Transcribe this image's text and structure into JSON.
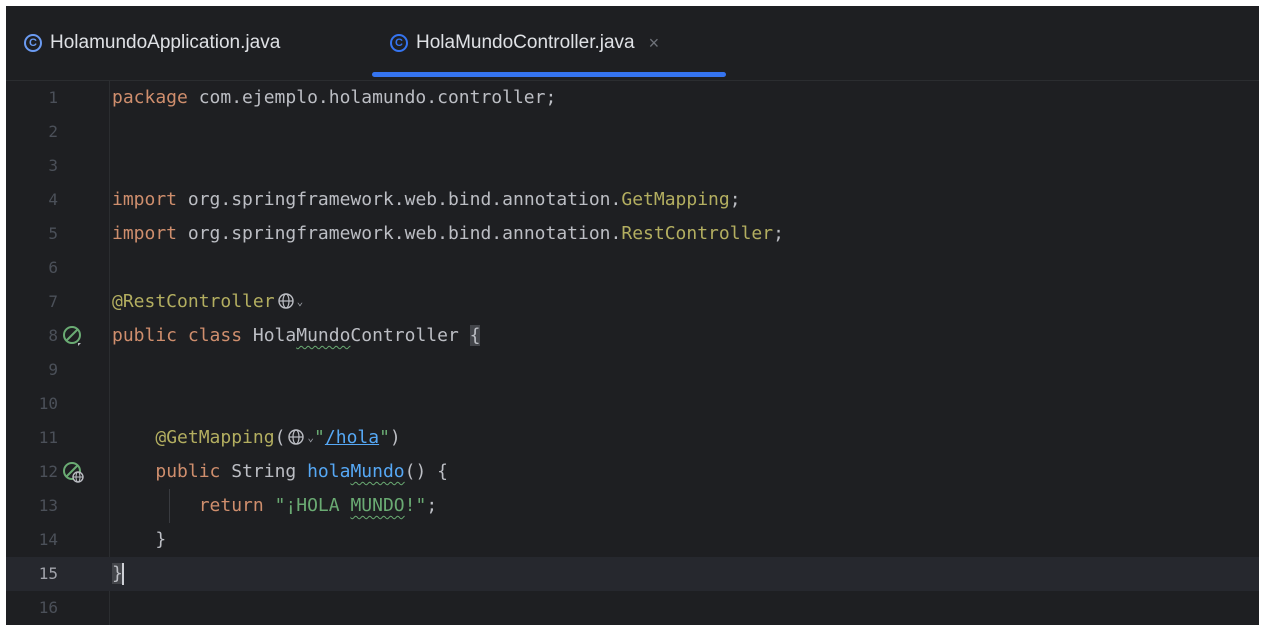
{
  "tabs": [
    {
      "label": "HolamundoApplication.java",
      "icon": "spring-class-icon",
      "active": false
    },
    {
      "label": "HolaMundoController.java",
      "icon": "class-icon",
      "active": true,
      "close": "×"
    }
  ],
  "colors": {
    "accent": "#3574f0",
    "background": "#1e1f22",
    "keyword": "#cf8e6d",
    "annotation": "#b3ae60",
    "string": "#6aab73",
    "method": "#56a8f5"
  },
  "code": {
    "line_numbers": [
      "1",
      "2",
      "3",
      "4",
      "5",
      "6",
      "7",
      "8",
      "9",
      "10",
      "11",
      "12",
      "13",
      "14",
      "15",
      "16"
    ],
    "l1": {
      "kw": "package",
      "rest": " com.ejemplo.holamundo.controller;"
    },
    "l4": {
      "kw": "import",
      "pkg": " org.springframework.web.bind.annotation.",
      "cls": "GetMapping",
      "end": ";"
    },
    "l5": {
      "kw": "import",
      "pkg": " org.springframework.web.bind.annotation.",
      "cls": "RestController",
      "end": ";"
    },
    "l7": {
      "ann": "@RestController"
    },
    "l8": {
      "kw": "public class",
      "name_a": " Hola",
      "name_b": "Mundo",
      "name_c": "Controller ",
      "brace": "{"
    },
    "l11": {
      "ann": "@GetMapping",
      "open": "(",
      "q1": "\"",
      "url": "/hola",
      "q2": "\"",
      "close": ")"
    },
    "l12": {
      "kw": "public",
      "type": " String ",
      "fn_a": "hola",
      "fn_b": "Mundo",
      "rest": "() {"
    },
    "l13": {
      "kw": "return",
      "str_a": " \"¡HOLA ",
      "str_b": "MUNDO",
      "str_c": "!\"",
      "end": ";"
    },
    "l14": {
      "text": "}"
    },
    "l15": {
      "text": "}"
    }
  },
  "gutter_icons": {
    "line8": "spring-bean-icon",
    "line12": "web-endpoint-icon"
  }
}
